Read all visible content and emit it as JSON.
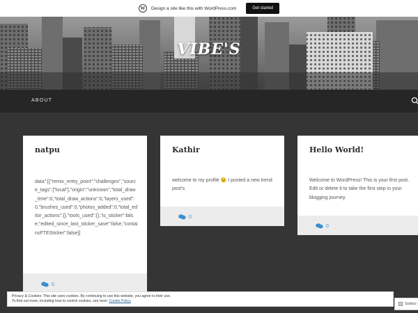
{
  "promo": {
    "text": "Design a site like this with WordPress.com",
    "button_label": "Get started"
  },
  "header": {
    "site_title": "VIBE'S"
  },
  "nav": {
    "items": [
      {
        "label": "ABOUT"
      }
    ]
  },
  "posts": [
    {
      "title": "natpu",
      "excerpt": "data\":[{\"remix_entry_point\":\"challenges\",\"source_tags\":[\"local\"],\"origin\":\"unknown\",\"total_draw_time\":0,\"total_draw_actions\":0,\"layers_used\":0,\"brushes_used\":0,\"photos_added\":0,\"total_editor_actions\":{},\"tools_used\":{},\"is_sticker\":false,\"edited_since_last_sticker_save\":false,\"containsFTESticker\":false}]",
      "comment_count": "0"
    },
    {
      "title": "Kathir",
      "excerpt": "welcome to my profile 😉 I posted a new trend post's",
      "comment_count": "0"
    },
    {
      "title": "Hello World!",
      "excerpt": "Welcome to WordPress! This is your first post. Edit or delete it to take the first step in your blogging journey.",
      "comment_count": "0"
    }
  ],
  "cookie_banner": {
    "line1": "Privacy & Cookies: This site uses cookies. By continuing to use this website, you agree to their use.",
    "line2_prefix": "To find out more, including how to control cookies, see here: ",
    "link": "Cookie Policy"
  },
  "follow": {
    "label": "Subscr"
  },
  "colors": {
    "page_bg": "#353535",
    "nav_bg": "#262626",
    "card_bg": "#ffffff",
    "footer_bg": "#ececec",
    "link_blue": "#3b8fd0"
  }
}
